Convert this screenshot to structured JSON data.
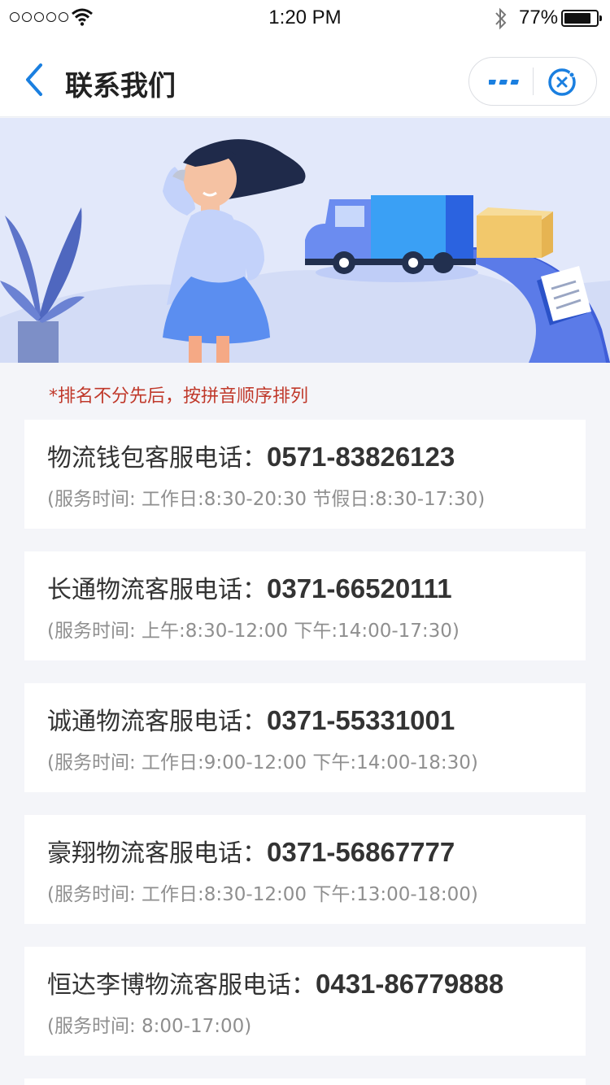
{
  "status_bar": {
    "time": "1:20 PM",
    "battery": "77%",
    "battery_level": 0.77
  },
  "nav": {
    "title": "联系我们",
    "back_icon": "chevron-left-icon",
    "more_icon": "more-dots-icon",
    "close_icon": "close-circle-icon",
    "accent": "#1a7fe0"
  },
  "banner": {
    "colors": {
      "bg": "#e2e8fa",
      "truck": "#3aa0f5",
      "road": "#5b7be8",
      "box": "#f2c86b"
    }
  },
  "notice": "*排名不分先后，按拼音顺序排列",
  "contacts": [
    {
      "label": "物流钱包客服电话：",
      "phone": "0571-83826123",
      "hours": "(服务时间: 工作日:8:30-20:30 节假日:8:30-17:30)"
    },
    {
      "label": "长通物流客服电话：",
      "phone": "0371-66520111",
      "hours": "(服务时间: 上午:8:30-12:00 下午:14:00-17:30)"
    },
    {
      "label": "诚通物流客服电话：",
      "phone": "0371-55331001",
      "hours": "(服务时间: 工作日:9:00-12:00 下午:14:00-18:30)"
    },
    {
      "label": "豪翔物流客服电话：",
      "phone": "0371-56867777",
      "hours": "(服务时间: 工作日:8:30-12:00 下午:13:00-18:00)"
    },
    {
      "label": "恒达李博物流客服电话：",
      "phone": "0431-86779888",
      "hours": "(服务时间: 8:00-17:00)"
    }
  ]
}
